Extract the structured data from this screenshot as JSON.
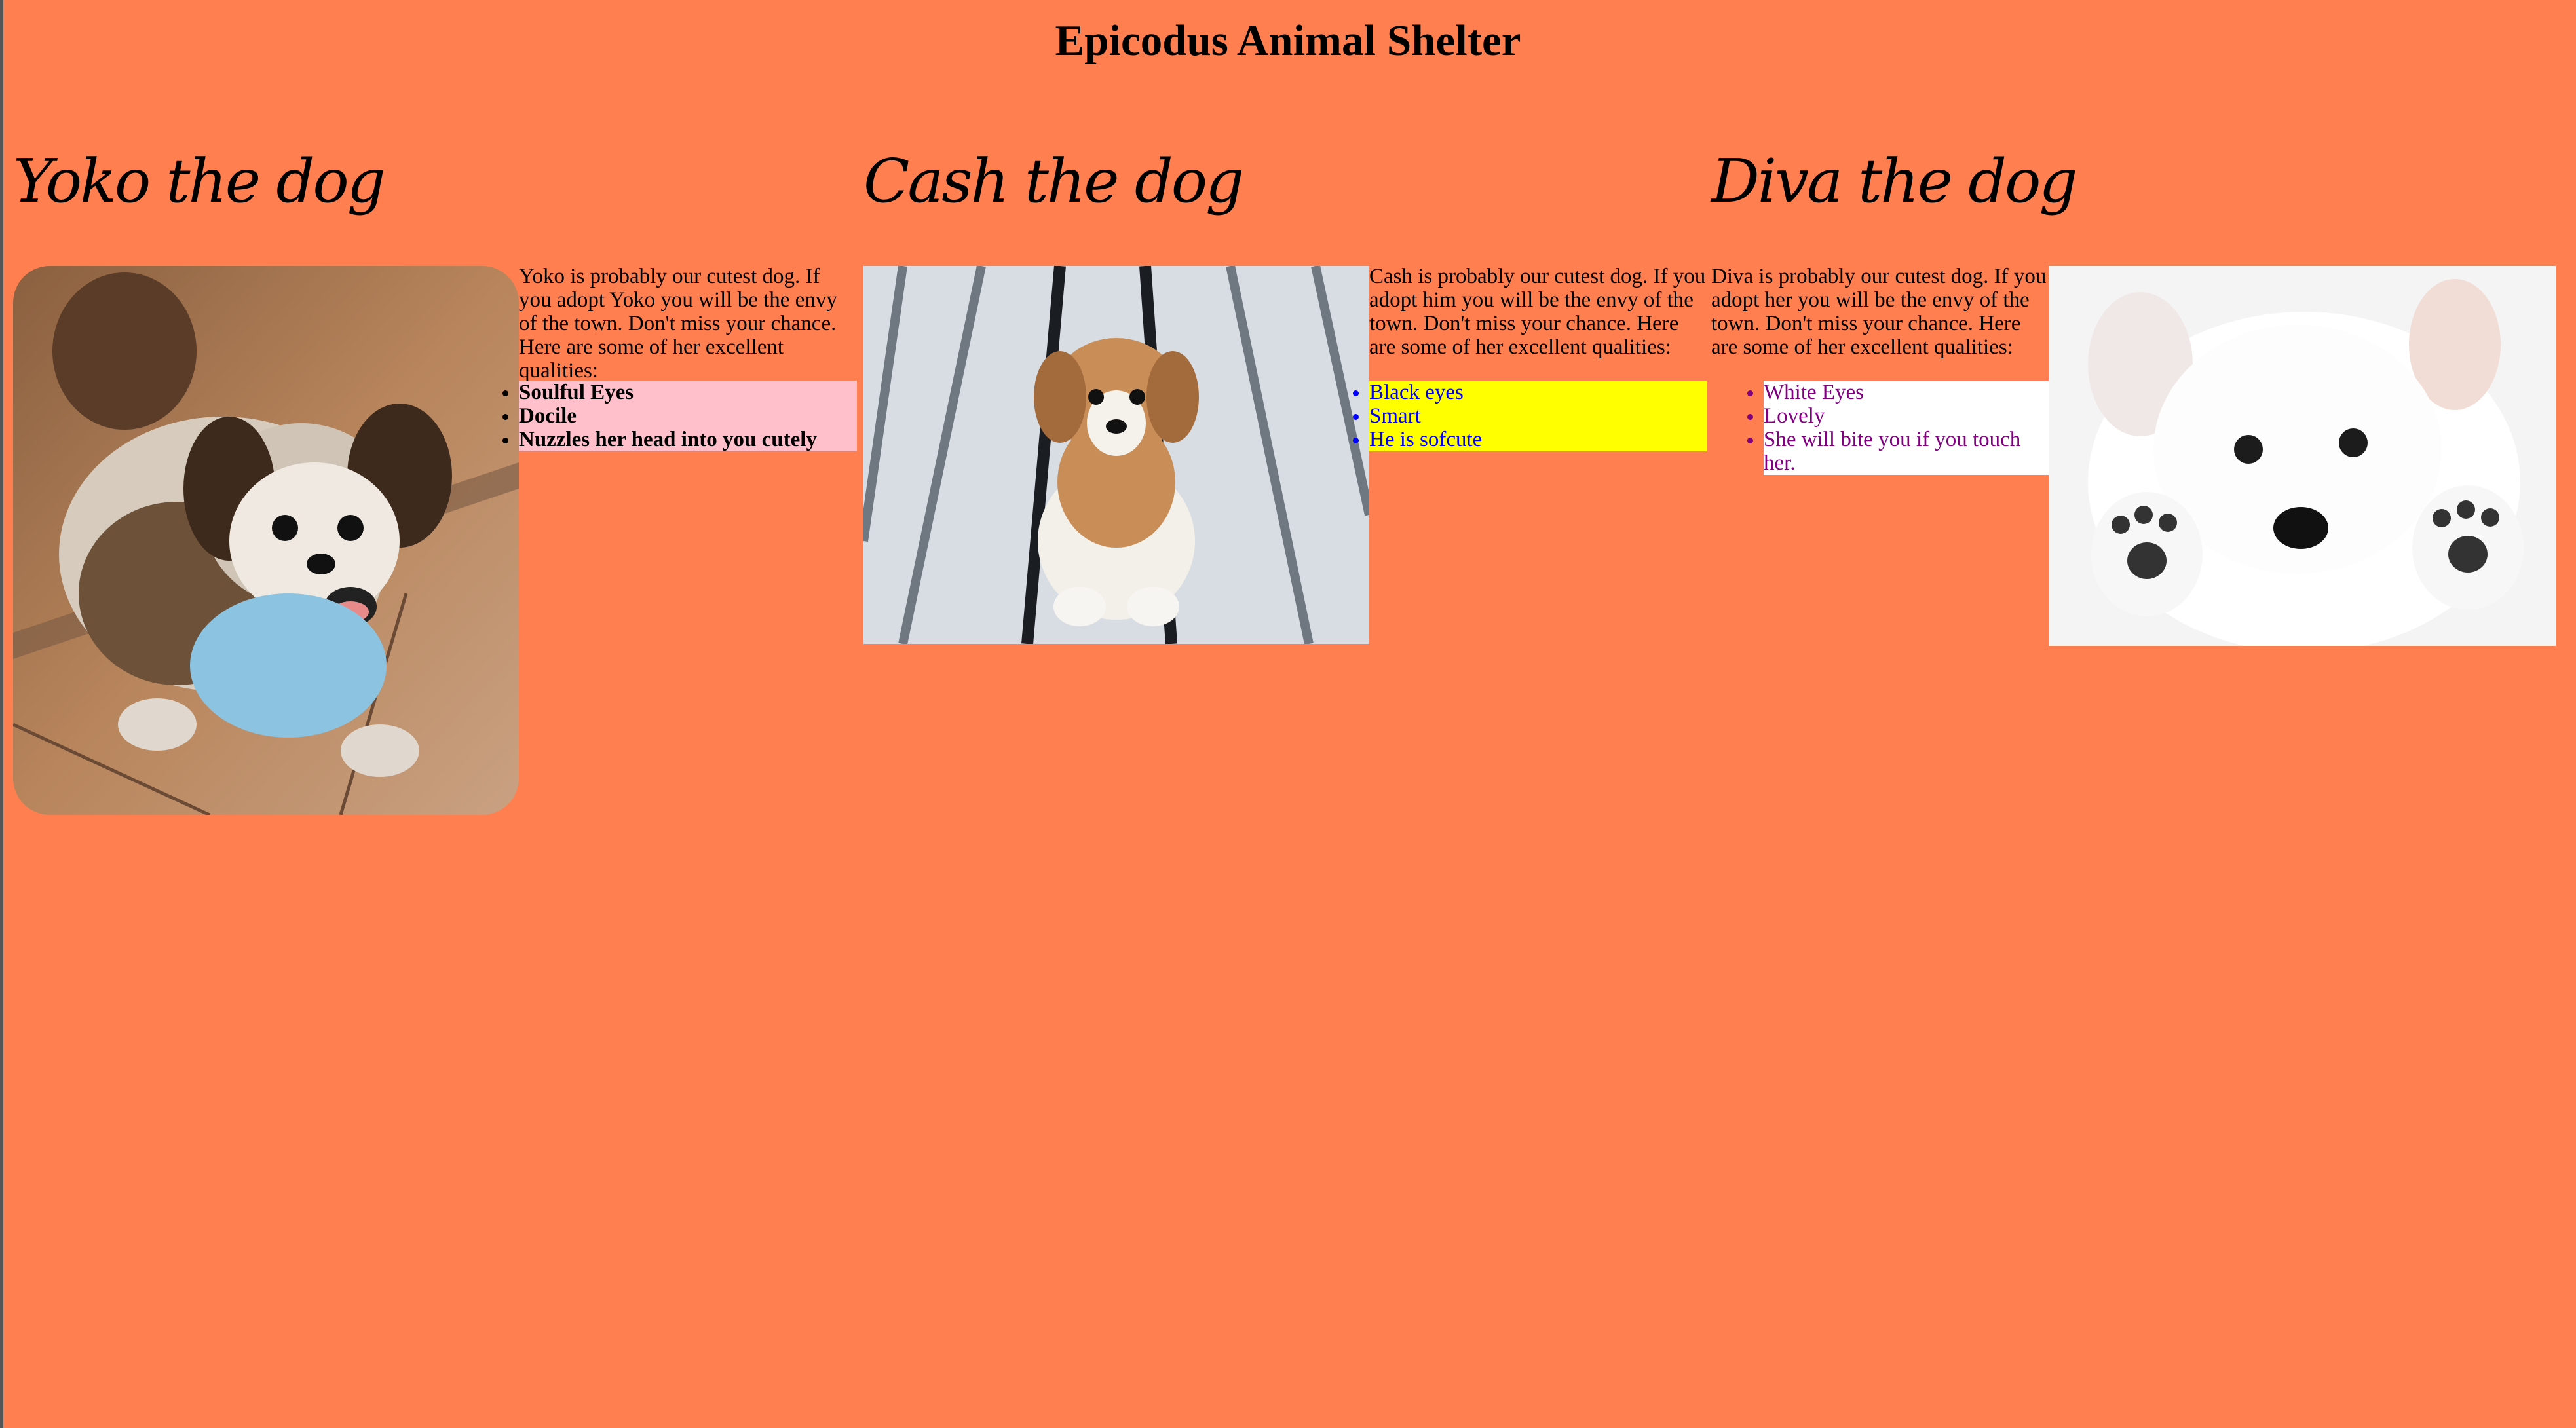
{
  "page": {
    "title": "Epicodus Animal Shelter",
    "background_color": "#ff7f50"
  },
  "dogs": [
    {
      "name": "Yoko the dog",
      "description": "Yoko is probably our cutest dog. If you adopt Yoko you will be the envy of the town. Don't miss your chance. Here are some of her excellent qualities:",
      "qualities": [
        "Soulful Eyes",
        "Docile",
        "Nuzzles her head into you cutely"
      ],
      "qualities_background": "#ffc0cb",
      "qualities_color": "#000000",
      "photo": "dog-photo-shih-tzu"
    },
    {
      "name": "Cash the dog",
      "description": "Cash is probably our cutest dog. If you adopt him you will be the envy of the town. Don't miss your chance. Here are some of her excellent qualities:",
      "qualities": [
        "Black eyes",
        "Smart",
        "He is sofcute"
      ],
      "qualities_background": "#ffff00",
      "qualities_color": "#0000ff",
      "photo": "dog-photo-puppy-on-deck"
    },
    {
      "name": "Diva the dog",
      "description": "Diva is probably our cutest dog. If you adopt her you will be the envy of the town. Don't miss your chance. Here are some of her excellent qualities:",
      "qualities": [
        "White Eyes",
        "Lovely",
        "She will bite you if you touch her."
      ],
      "qualities_background": "#ffffff",
      "qualities_color": "#800080",
      "photo": "dog-photo-white-puppy"
    }
  ]
}
